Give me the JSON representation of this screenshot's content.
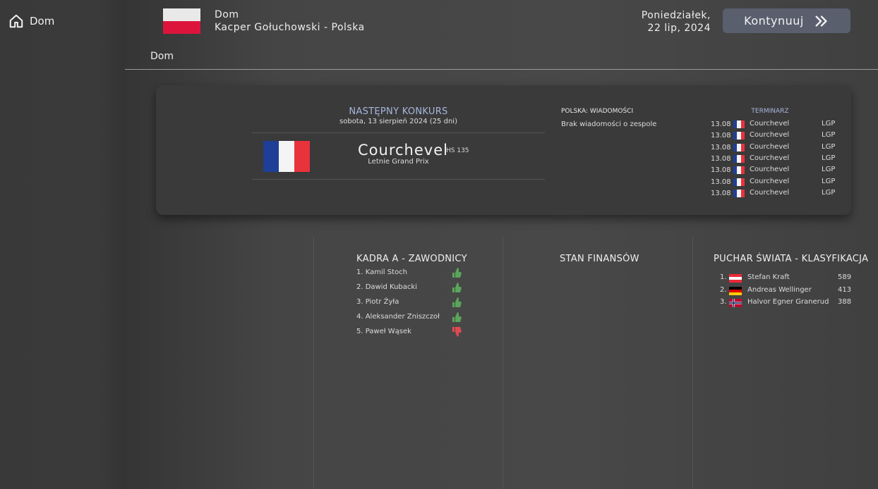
{
  "sidebar": {
    "home_label": "Dom"
  },
  "header": {
    "title": "Dom",
    "subtitle": "Kacper Gołuchowski - Polska",
    "day": "Poniedziałek,",
    "date": "22 lip, 2024",
    "continue_label": "Kontynuuj",
    "breadcrumb": "Dom"
  },
  "next_contest": {
    "title": "NASTĘPNY KONKURS",
    "date": "sobota, 13 sierpień 2024 (25 dni)",
    "venue": "Courchevel",
    "hill": "HS 135",
    "competition": "Letnie Grand Prix"
  },
  "news": {
    "title": "POLSKA: WIADOMOŚCI",
    "empty_text": "Brak wiadomości o zespole"
  },
  "schedule": {
    "title": "TERMINARZ",
    "rows": [
      {
        "date": "13.08",
        "venue": "Courchevel",
        "type": "LGP"
      },
      {
        "date": "13.08",
        "venue": "Courchevel",
        "type": "LGP"
      },
      {
        "date": "13.08",
        "venue": "Courchevel",
        "type": "LGP"
      },
      {
        "date": "13.08",
        "venue": "Courchevel",
        "type": "LGP"
      },
      {
        "date": "13.08",
        "venue": "Courchevel",
        "type": "LGP"
      },
      {
        "date": "13.08",
        "venue": "Courchevel",
        "type": "LGP"
      },
      {
        "date": "13.08",
        "venue": "Courchevel",
        "type": "LGP"
      }
    ]
  },
  "squad": {
    "title": "KADRA A - ZAWODNICY",
    "players": [
      {
        "label": "1. Kamil Stoch",
        "form": "up"
      },
      {
        "label": "2. Dawid Kubacki",
        "form": "up"
      },
      {
        "label": "3. Piotr Żyła",
        "form": "up"
      },
      {
        "label": "4. Aleksander Zniszczoł",
        "form": "up"
      },
      {
        "label": "5. Paweł Wąsek",
        "form": "down"
      }
    ]
  },
  "finances": {
    "title": "STAN FINANSÓW"
  },
  "world_cup": {
    "title": "PUCHAR ŚWIATA - KLASYFIKACJA",
    "rows": [
      {
        "pos": "1.",
        "name": "Stefan Kraft",
        "points": "589",
        "country": "AUT"
      },
      {
        "pos": "2.",
        "name": "Andreas Wellinger",
        "points": "413",
        "country": "GER"
      },
      {
        "pos": "3.",
        "name": "Halvor Egner Granerud",
        "points": "388",
        "country": "NOR"
      }
    ]
  },
  "colors": {
    "accent": "#a7b6dd",
    "button": "#5a5f6e",
    "thumb_up": "#5aa55a",
    "thumb_down": "#e04a52"
  }
}
